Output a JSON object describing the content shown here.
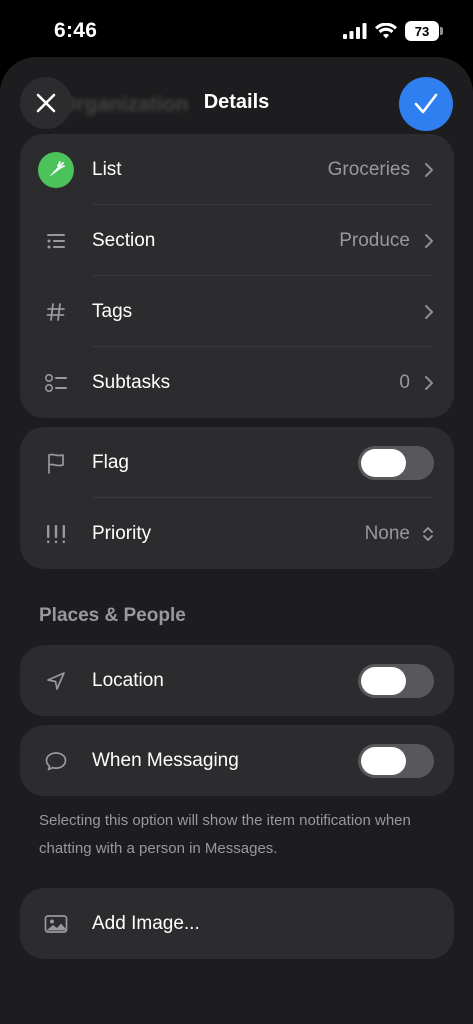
{
  "status_bar": {
    "time": "6:46",
    "battery": "73"
  },
  "nav": {
    "title": "Details",
    "background_title": "Organization"
  },
  "organization": [
    {
      "label": "List",
      "value": "Groceries",
      "icon": "carrot-icon"
    },
    {
      "label": "Section",
      "value": "Produce",
      "icon": "section-list-icon"
    },
    {
      "label": "Tags",
      "value": "",
      "icon": "hashtag-icon"
    },
    {
      "label": "Subtasks",
      "value": "0",
      "icon": "subtasks-icon"
    }
  ],
  "flag": {
    "label": "Flag",
    "enabled": false
  },
  "priority": {
    "label": "Priority",
    "value": "None"
  },
  "places_people": {
    "header": "Places & People",
    "location": {
      "label": "Location",
      "enabled": false
    },
    "messaging": {
      "label": "When Messaging",
      "enabled": false
    },
    "footnote": "Selecting this option will show the item notification when chatting with a person in Messages."
  },
  "add_image": {
    "label": "Add Image..."
  },
  "colors": {
    "accent": "#2f7ff0",
    "list_icon_bg": "#4cc35a",
    "sheet_bg": "#1d1d1f",
    "group_bg": "#2c2c2e"
  }
}
